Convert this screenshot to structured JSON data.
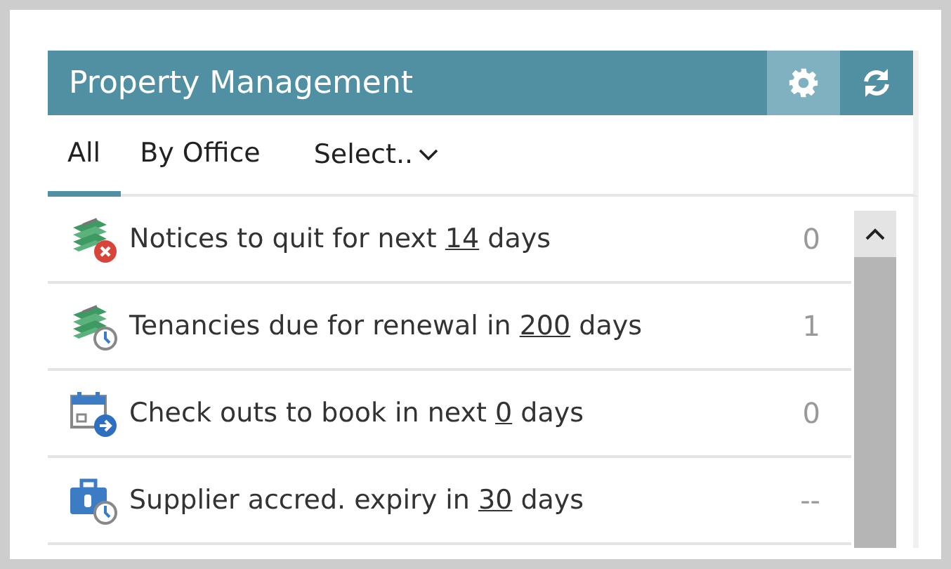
{
  "header": {
    "title": "Property Management",
    "settings_active": true
  },
  "tabs": [
    {
      "label": "All",
      "selected": true
    },
    {
      "label": "By Office",
      "selected": false
    }
  ],
  "select": {
    "label": "Select.."
  },
  "rows": [
    {
      "kind": "money-cross",
      "before": "Notices to quit for next ",
      "days": "14",
      "after": " days",
      "count": "0"
    },
    {
      "kind": "money-clock",
      "before": "Tenancies due for renewal in ",
      "days": "200",
      "after": " days",
      "count": "1"
    },
    {
      "kind": "calendar-arrow",
      "before": "Check outs to book in next ",
      "days": "0",
      "after": " days",
      "count": "0"
    },
    {
      "kind": "case-clock",
      "before": "Supplier accred. expiry in ",
      "days": "30",
      "after": " days",
      "count": "--"
    }
  ]
}
